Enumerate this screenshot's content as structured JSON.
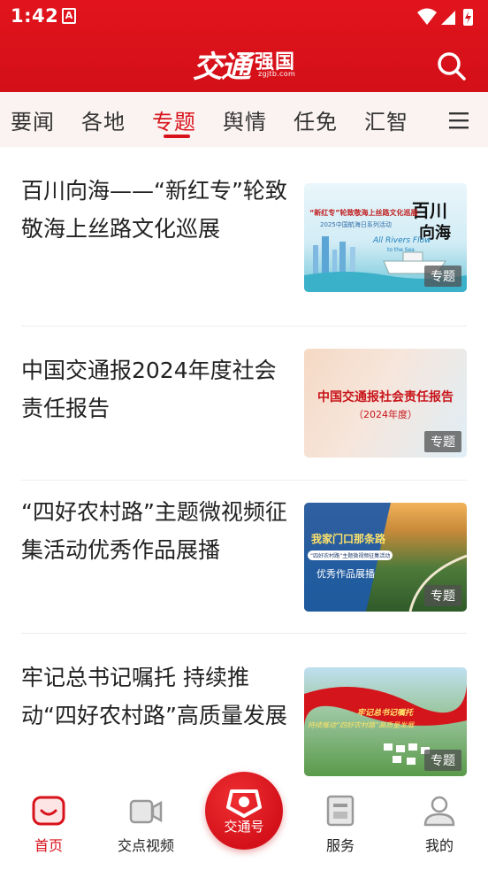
{
  "status_bar": {
    "time": "1:42",
    "notif_glyph": "A"
  },
  "header": {
    "logo_main": "交通",
    "logo_sub": "强国",
    "logo_url": "zgjtb.com"
  },
  "tabs": [
    {
      "label": "要闻"
    },
    {
      "label": "各地"
    },
    {
      "label": "专题"
    },
    {
      "label": "舆情"
    },
    {
      "label": "任免"
    },
    {
      "label": "汇智"
    }
  ],
  "active_tab": "专题",
  "articles": [
    {
      "title": "百川向海——“新红专”轮致敬海上丝路文化巡展",
      "badge": "专题",
      "thumb_text": [
        "“新红专”轮致敬海上丝路文化巡展",
        "2025中国航海日系列活动",
        "All Rivers Flow",
        "to the Sea",
        "百川",
        "向海"
      ]
    },
    {
      "title": "中国交通报2024年度社会责任报告",
      "badge": "专题",
      "thumb_text": [
        "中国交通报社会责任报告",
        "（2024年度）"
      ]
    },
    {
      "title": "“四好农村路”主题微视频征集活动优秀作品展播",
      "badge": "专题",
      "thumb_text": [
        "我家门口那条路",
        "“四好农村路”主题微视频征集活动",
        "优秀作品展播"
      ]
    },
    {
      "title": "牢记总书记嘱托  持续推动“四好农村路”高质量发展",
      "badge": "专题",
      "thumb_text": [
        "牢记总书记嘱托",
        "持续推动“四好农村路”高质量发展"
      ]
    }
  ],
  "bottom_nav": [
    {
      "label": "首页",
      "icon": "home-icon"
    },
    {
      "label": "交点视频",
      "icon": "video-icon"
    },
    {
      "label": "交通号",
      "icon": "jiaotong-hao-icon"
    },
    {
      "label": "服务",
      "icon": "service-icon"
    },
    {
      "label": "我的",
      "icon": "user-icon"
    }
  ],
  "colors": {
    "brand_red": "#d8121b",
    "tab_bar_bg": "#fbf3f2"
  }
}
